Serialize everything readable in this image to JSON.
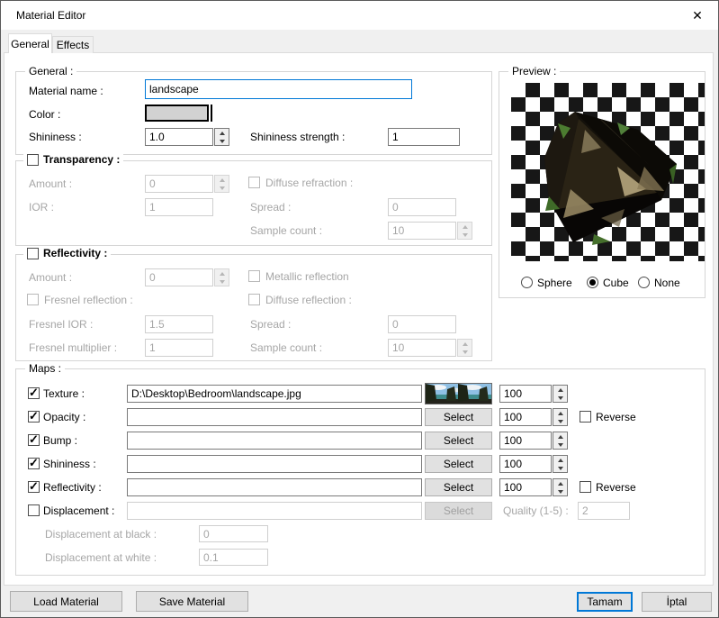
{
  "window": {
    "title": "Material Editor"
  },
  "icons": {
    "close": "✕",
    "check": "✓"
  },
  "tabs": [
    {
      "label": "General"
    },
    {
      "label": "Effects"
    }
  ],
  "general": {
    "legend": "General :",
    "material_name_label": "Material name :",
    "material_name_value": "landscape",
    "color_label": "Color :",
    "color_value": "#d2d2d2",
    "shininess_label": "Shininess :",
    "shininess_value": "1.0",
    "shininess_strength_label": "Shininess strength :",
    "shininess_strength_value": "1"
  },
  "transparency": {
    "legend": "Transparency :",
    "checked": false,
    "amount_label": "Amount :",
    "amount_value": "0",
    "ior_label": "IOR :",
    "ior_value": "1",
    "diffuse_refraction_label": "Diffuse refraction :",
    "spread_label": "Spread :",
    "spread_value": "0",
    "sample_count_label": "Sample count :",
    "sample_count_value": "10"
  },
  "reflectivity": {
    "legend": "Reflectivity :",
    "checked": false,
    "amount_label": "Amount :",
    "amount_value": "0",
    "metallic_label": "Metallic reflection",
    "fresnel_label": "Fresnel reflection :",
    "diffuse_label": "Diffuse reflection :",
    "fresnel_ior_label": "Fresnel IOR :",
    "fresnel_ior_value": "1.5",
    "spread_label": "Spread :",
    "spread_value": "0",
    "fresnel_mult_label": "Fresnel multiplier :",
    "fresnel_mult_value": "1",
    "sample_count_label": "Sample count :",
    "sample_count_value": "10"
  },
  "maps": {
    "legend": "Maps :",
    "select_label": "Select",
    "reverse_label": "Reverse",
    "rows": [
      {
        "label": "Texture :",
        "checked": true,
        "value": "D:\\Desktop\\Bedroom\\landscape.jpg",
        "amount": "100"
      },
      {
        "label": "Opacity :",
        "checked": true,
        "value": "",
        "amount": "100"
      },
      {
        "label": "Bump :",
        "checked": true,
        "value": "",
        "amount": "100"
      },
      {
        "label": "Shininess :",
        "checked": true,
        "value": "",
        "amount": "100"
      },
      {
        "label": "Reflectivity :",
        "checked": true,
        "value": "",
        "amount": "100"
      },
      {
        "label": "Displacement :",
        "checked": false,
        "value": ""
      }
    ],
    "quality_label": "Quality (1-5) :",
    "quality_value": "2",
    "disp_black_label": "Displacement at black :",
    "disp_black_value": "0",
    "disp_white_label": "Displacement at white :",
    "disp_white_value": "0.1"
  },
  "preview": {
    "legend": "Preview :",
    "radios": [
      {
        "label": "Sphere",
        "selected": false
      },
      {
        "label": "Cube",
        "selected": true
      },
      {
        "label": "None",
        "selected": false
      }
    ]
  },
  "footer": {
    "load": "Load Material",
    "save": "Save Material",
    "ok": "Tamam",
    "cancel": "İptal"
  }
}
